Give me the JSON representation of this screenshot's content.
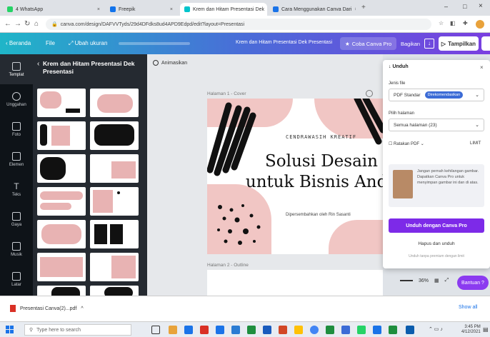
{
  "browser": {
    "tabs": [
      {
        "label": "4 WhatsApp",
        "color": "#25d366"
      },
      {
        "label": "Freepik",
        "color": "#1273eb"
      },
      {
        "label": "Krem dan Hitam Presentasi Dek",
        "color": "#00c4cc"
      },
      {
        "label": "Cara Menggunakan Canva Dari",
        "color": "#1a73e8"
      }
    ],
    "address": "canva.com/design/DAFVVTyds/29d4DFdks8ud4APD9Edpd/edit?layout=Presentasi",
    "window_controls": [
      "–",
      "□",
      "×"
    ]
  },
  "canva_topbar": {
    "beranda": "Beranda",
    "file": "File",
    "ubah_ukuran": "Ubah ukuran",
    "doc_title": "Krem dan Hitam Presentasi Dek Presentasi",
    "coba_pro": "Coba Canva Pro",
    "bagikan": "Bagikan",
    "tampilkan": "Tampilkan"
  },
  "rail": [
    {
      "label": "Templat",
      "icon": "template-icon"
    },
    {
      "label": "Unggahan",
      "icon": "upload-icon"
    },
    {
      "label": "Foto",
      "icon": "photo-icon"
    },
    {
      "label": "Elemen",
      "icon": "elements-icon"
    },
    {
      "label": "Teks",
      "icon": "text-icon"
    },
    {
      "label": "Gaya",
      "icon": "style-icon"
    },
    {
      "label": "Musik",
      "icon": "music-icon"
    },
    {
      "label": "Latar",
      "icon": "background-icon"
    }
  ],
  "panel": {
    "back": "‹",
    "title": "Krem dan Hitam Presentasi Dek Presentasi"
  },
  "workspace": {
    "animate": "Animasikan",
    "page1_label": "Halaman 1 - Cover",
    "page2_label": "Halaman 2 - Outline",
    "slide": {
      "subtitle": "CENDRAWASIH KREATIF",
      "title": "Solusi Desain untuk Bisnis Anda",
      "by": "Dipersembahkan oleh Rin Sasanti"
    }
  },
  "download": {
    "header": "Unduh",
    "type_label": "Jenis file",
    "type_value": "PDF Standar",
    "type_badge": "Direkomendasikan",
    "pages_label": "Pilih halaman",
    "pages_value": "Semua halaman (23)",
    "flatten": "Ratakan PDF",
    "limit": "LIMIT",
    "promo_text": "Jangan pernah kehilangan gambar. Dapatkan Canva Pro untuk menyimpan gambar ini dan di atas.",
    "primary": "Unduh dengan Canva Pro",
    "secondary": "Hapus dan unduh",
    "footnote": "Unduh tanpa premium dengan limit"
  },
  "zoom": {
    "value": "36%"
  },
  "help": "Bantuan ?",
  "shelf": {
    "file": "Presentasi Canva(2)...pdf",
    "show_all": "Show all"
  },
  "taskbar": {
    "search_placeholder": "Type here to search",
    "time": "3:45 PM",
    "date": "4/12/2021"
  }
}
